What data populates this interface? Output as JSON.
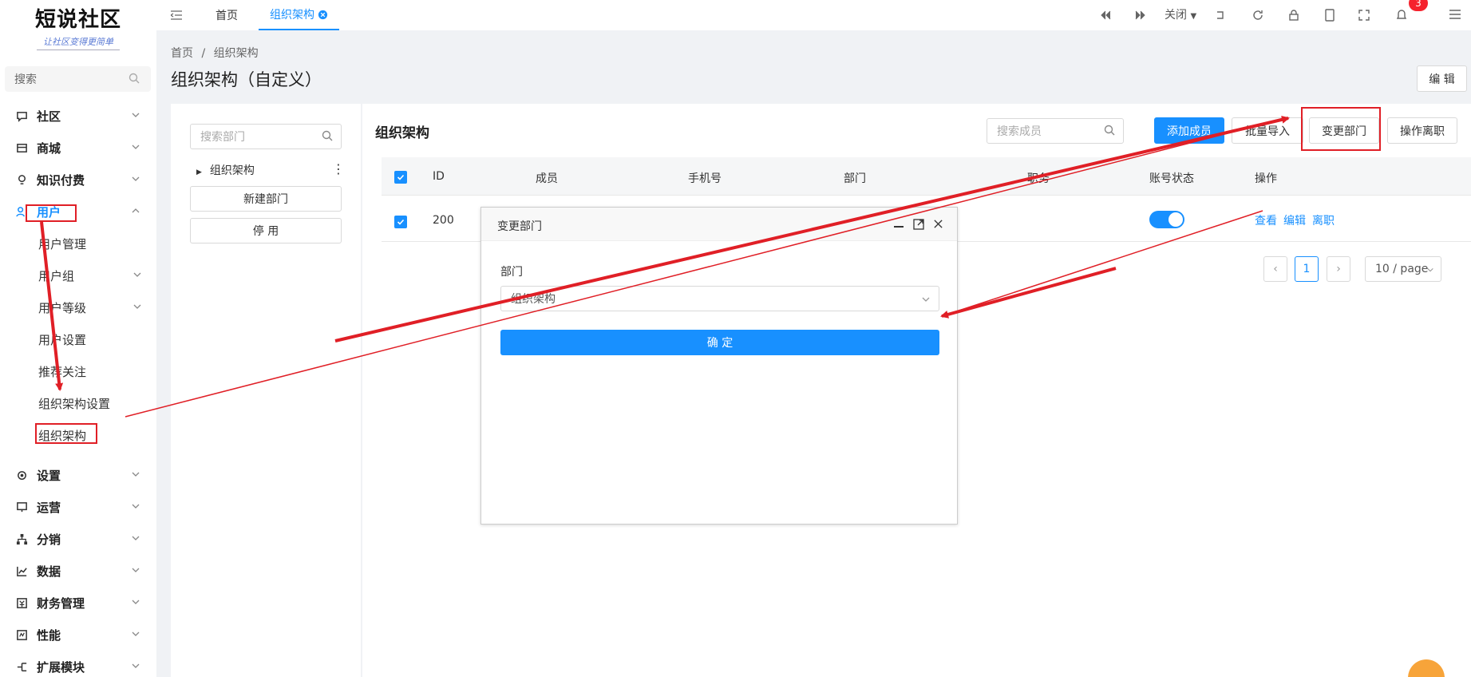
{
  "logo": {
    "title": "短说社区",
    "subtitle": "让社区变得更简单"
  },
  "sidebar": {
    "search_placeholder": "搜索",
    "menu": [
      {
        "label": "社区",
        "icon": "chat-icon"
      },
      {
        "label": "商城",
        "icon": "shop-icon"
      },
      {
        "label": "知识付费",
        "icon": "bulb-icon"
      },
      {
        "label": "用户",
        "icon": "user-icon"
      },
      {
        "label": "设置",
        "icon": "gear-icon"
      },
      {
        "label": "运营",
        "icon": "monitor-icon"
      },
      {
        "label": "分销",
        "icon": "network-icon"
      },
      {
        "label": "数据",
        "icon": "chart-icon"
      },
      {
        "label": "财务管理",
        "icon": "finance-icon"
      },
      {
        "label": "性能",
        "icon": "performance-icon"
      },
      {
        "label": "扩展模块",
        "icon": "extension-icon"
      }
    ],
    "user_submenu": [
      "用户管理",
      "用户组",
      "用户等级",
      "用户设置",
      "推荐关注",
      "组织架构设置",
      "组织架构"
    ]
  },
  "topbar": {
    "tabs": [
      "首页",
      "组织架构"
    ],
    "close_label": "关闭",
    "notification_count": "3"
  },
  "header": {
    "breadcrumb": [
      "首页",
      "组织架构"
    ],
    "title": "组织架构（自定义）",
    "edit_label": "编 辑"
  },
  "dept_panel": {
    "search_placeholder": "搜索部门",
    "tree_root": "组织架构",
    "new_dept_label": "新建部门",
    "disable_label": "停 用"
  },
  "members": {
    "title": "组织架构",
    "search_placeholder": "搜索成员",
    "buttons": {
      "add": "添加成员",
      "import": "批量导入",
      "change_dept": "变更部门",
      "resign": "操作离职"
    },
    "columns": [
      "ID",
      "成员",
      "手机号",
      "部门",
      "职务",
      "账号状态",
      "操作"
    ],
    "rows": [
      {
        "id": "200",
        "status_on": true,
        "actions": [
          "查看",
          "编辑",
          "离职"
        ]
      }
    ],
    "pagination": {
      "current": "1",
      "page_size": "10 / page"
    }
  },
  "dialog": {
    "title": "变更部门",
    "field_label": "部门",
    "select_value": "组织架构",
    "confirm_label": "确 定"
  },
  "colors": {
    "primary": "#1890ff",
    "annotation_red": "#e01f26"
  }
}
